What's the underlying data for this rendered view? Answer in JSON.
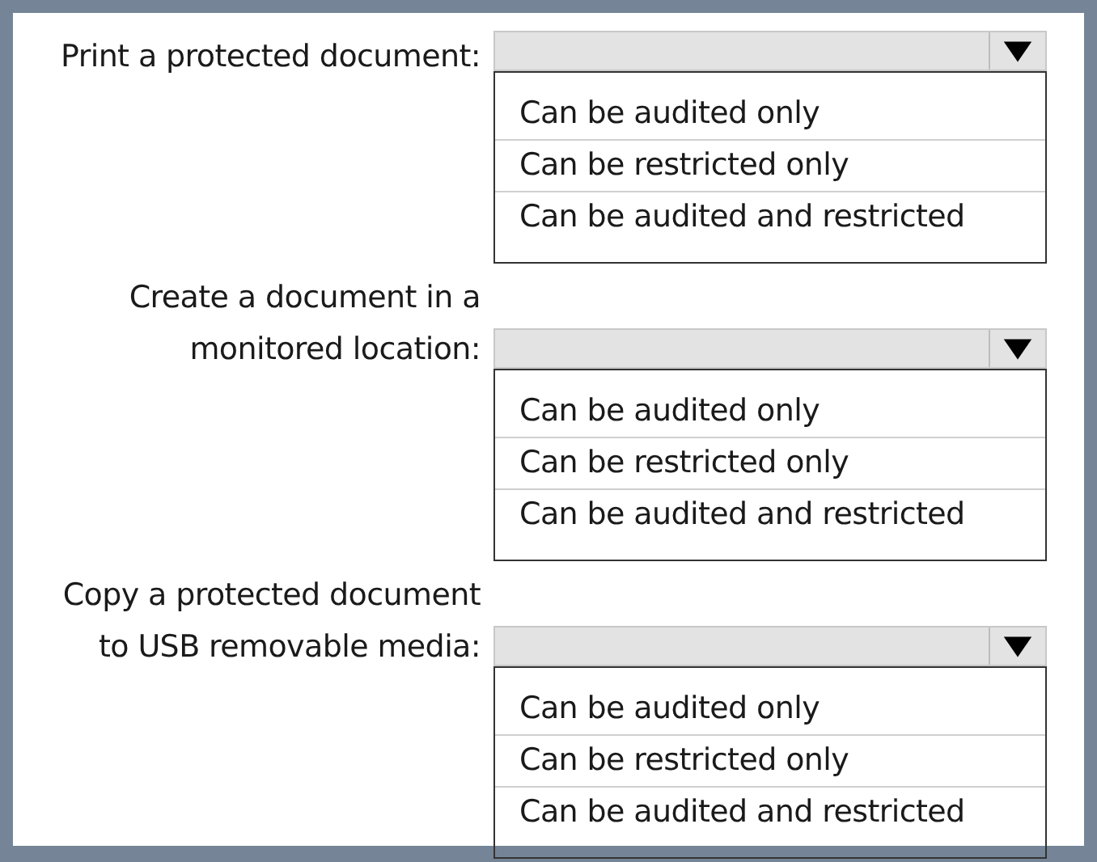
{
  "questions": [
    {
      "label_lines": [
        "Print a protected document:"
      ],
      "options": [
        "Can be audited only",
        "Can be restricted only",
        "Can be audited and restricted"
      ]
    },
    {
      "label_lines": [
        "Create a document in a",
        "monitored location:"
      ],
      "options": [
        "Can be audited only",
        "Can be restricted only",
        "Can be audited and restricted"
      ]
    },
    {
      "label_lines": [
        "Copy a protected document",
        "to USB removable media:"
      ],
      "options": [
        "Can be audited only",
        "Can be restricted only",
        "Can be audited and restricted"
      ]
    }
  ]
}
